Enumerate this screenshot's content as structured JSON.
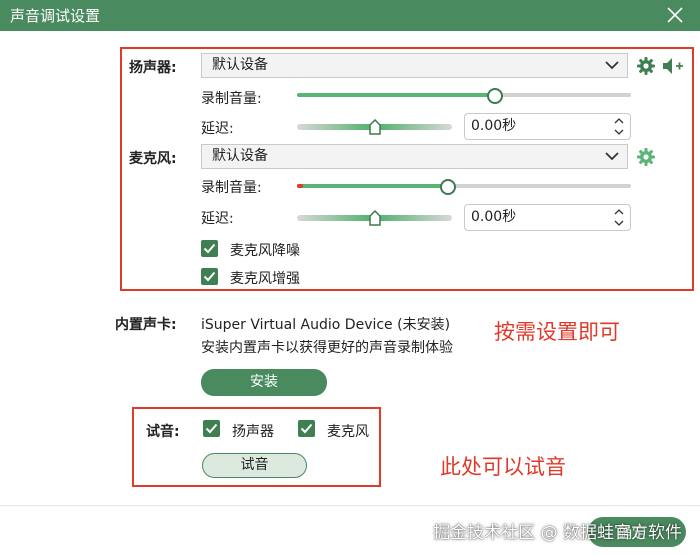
{
  "window": {
    "title": "声音调试设置"
  },
  "speaker": {
    "label": "扬声器:",
    "device": "默认设备",
    "volume_label": "录制音量:",
    "volume_level": 0.59,
    "delay_label": "延迟:",
    "delay_value": "0.00秒"
  },
  "mic": {
    "label": "麦克风:",
    "device": "默认设备",
    "volume_label": "录制音量:",
    "volume_level": 0.45,
    "delay_label": "延迟:",
    "delay_value": "0.00秒",
    "noise_reduction": {
      "label": "麦克风降噪",
      "checked": true
    },
    "enhance": {
      "label": "麦克风增强",
      "checked": true
    }
  },
  "soundcard": {
    "label": "内置声卡:",
    "device_name": "iSuper Virtual Audio Device (未安装)",
    "hint": "安装内置声卡以获得更好的声音录制体验",
    "install_button": "安装"
  },
  "test": {
    "label": "试音:",
    "speaker_check": {
      "label": "扬声器",
      "checked": true
    },
    "mic_check": {
      "label": "麦克风",
      "checked": true
    },
    "button": "试音"
  },
  "annotations": {
    "settings_note": "按需设置即可",
    "test_note": "此处可以试音"
  },
  "footer": {
    "ok_button": "确定",
    "watermark": "掘金技术社区 @ 数据蛙官方软件"
  },
  "colors": {
    "accent": "#4a8a5f",
    "slider_fill": "#5ab474",
    "annotation": "#e03a2a"
  },
  "icons": [
    "close-icon",
    "chevron-down-icon",
    "gear-icon",
    "speaker-icon",
    "check-icon",
    "spinner-arrows-icon"
  ]
}
